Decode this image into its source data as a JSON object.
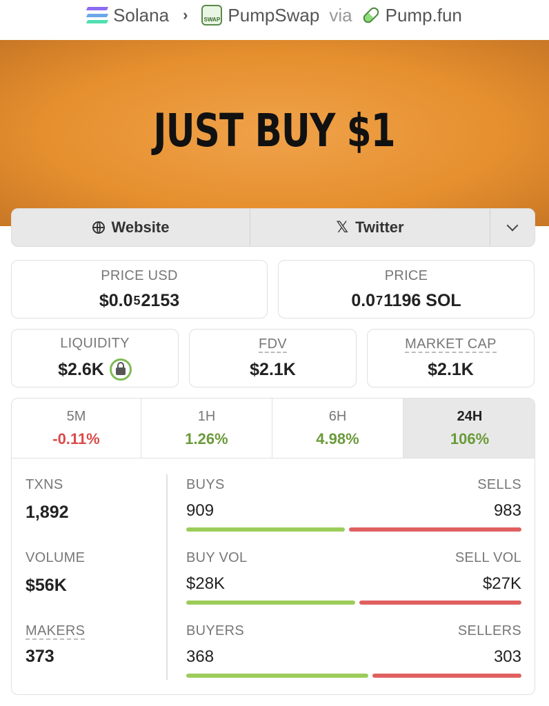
{
  "breadcrumb": {
    "chain": "Solana",
    "dex": "PumpSwap",
    "via": "via",
    "launchpad": "Pump.fun",
    "swap_icon_text": "SWAP"
  },
  "banner": {
    "text": "JUST BUY $1"
  },
  "links": {
    "website": "Website",
    "twitter": "Twitter"
  },
  "price_usd": {
    "label": "PRICE USD",
    "prefix": "$0.0",
    "subscript": "5",
    "suffix": "2153"
  },
  "price_native": {
    "label": "PRICE",
    "prefix": "0.0",
    "subscript": "7",
    "suffix": "1196 SOL"
  },
  "liquidity": {
    "label": "LIQUIDITY",
    "value": "$2.6K"
  },
  "fdv": {
    "label": "FDV",
    "value": "$2.1K"
  },
  "market_cap": {
    "label": "MARKET CAP",
    "value": "$2.1K"
  },
  "periods": [
    {
      "label": "5M",
      "change": "-0.11%",
      "trend": "negative"
    },
    {
      "label": "1H",
      "change": "1.26%",
      "trend": "positive"
    },
    {
      "label": "6H",
      "change": "4.98%",
      "trend": "positive"
    },
    {
      "label": "24H",
      "change": "106%",
      "trend": "positive",
      "selected": true
    }
  ],
  "stats": {
    "txns": {
      "label": "TXNS",
      "value": "1,892"
    },
    "volume": {
      "label": "VOLUME",
      "value": "$56K"
    },
    "makers": {
      "label": "MAKERS",
      "value": "373"
    }
  },
  "ratios": {
    "txns": {
      "left_label": "BUYS",
      "right_label": "SELLS",
      "left_value": "909",
      "right_value": "983",
      "left_fraction": 0.48
    },
    "volume": {
      "left_label": "BUY VOL",
      "right_label": "SELL VOL",
      "left_value": "$28K",
      "right_value": "$27K",
      "left_fraction": 0.51
    },
    "makers": {
      "left_label": "BUYERS",
      "right_label": "SELLERS",
      "left_value": "368",
      "right_value": "303",
      "left_fraction": 0.55
    }
  },
  "colors": {
    "positive": "#6a9a3a",
    "negative": "#d94a4a",
    "buy_bar": "#9ccc5a",
    "sell_bar": "#e06060",
    "banner": "#e58f2e"
  }
}
